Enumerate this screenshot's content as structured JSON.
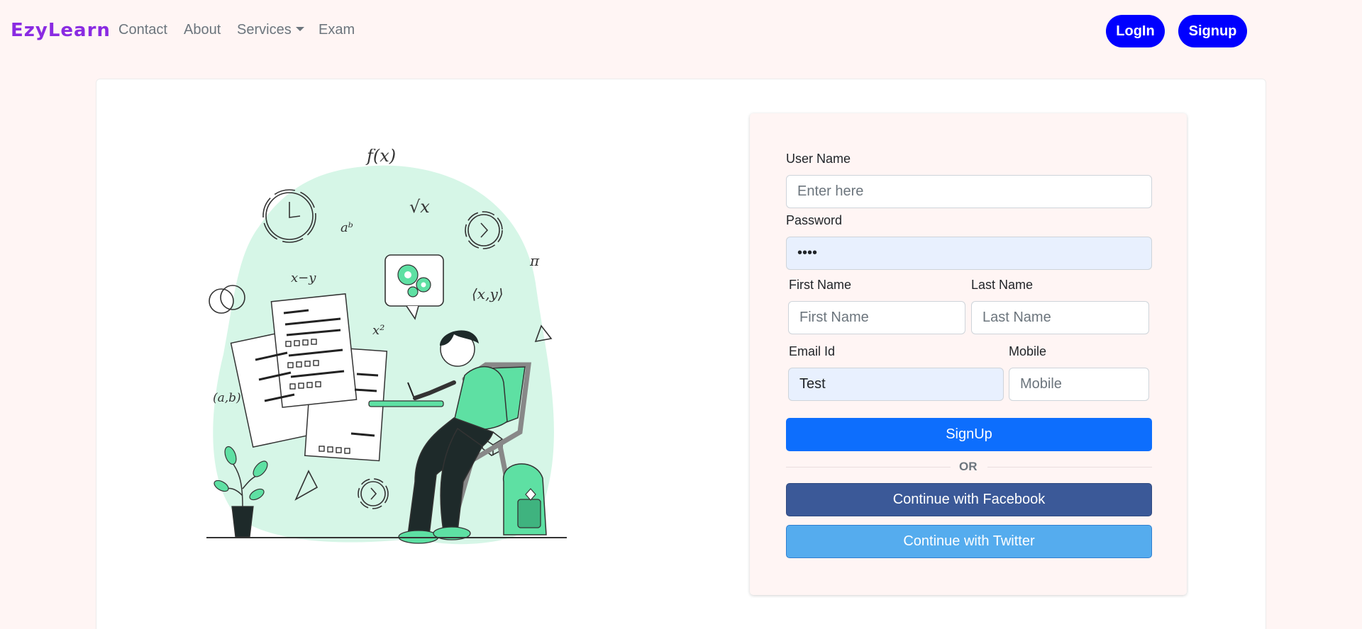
{
  "navbar": {
    "brand": "EzyLearn",
    "links": [
      "Contact",
      "About",
      "Services",
      "Exam"
    ],
    "login_label": "LogIn",
    "signup_label": "Signup"
  },
  "form": {
    "username": {
      "label": "User Name",
      "placeholder": "Enter here",
      "value": ""
    },
    "password": {
      "label": "Password",
      "value": "••••"
    },
    "first_name": {
      "label": "First Name",
      "placeholder": "First Name"
    },
    "last_name": {
      "label": "Last Name",
      "placeholder": "Last Name"
    },
    "email": {
      "label": "Email Id",
      "value": "Test"
    },
    "mobile": {
      "label": "Mobile",
      "placeholder": "Mobile"
    },
    "signup_button": "SignUp",
    "or_text": "OR",
    "facebook_button": "Continue with Facebook",
    "twitter_button": "Continue with Twitter"
  },
  "illustration": {
    "formulas": [
      "f(x)",
      "√x",
      "aᵇ",
      "x−y",
      "⟨x,y⟩",
      "x²",
      "(a,b)",
      "π"
    ]
  },
  "colors": {
    "brand": "#8a2be2",
    "nav_button": "#0000ff",
    "signup": "#0d6efd",
    "facebook": "#3b5998",
    "twitter": "#55acee",
    "illustration_green": "#5ee0a3",
    "illustration_blob": "#d6f6e7"
  }
}
